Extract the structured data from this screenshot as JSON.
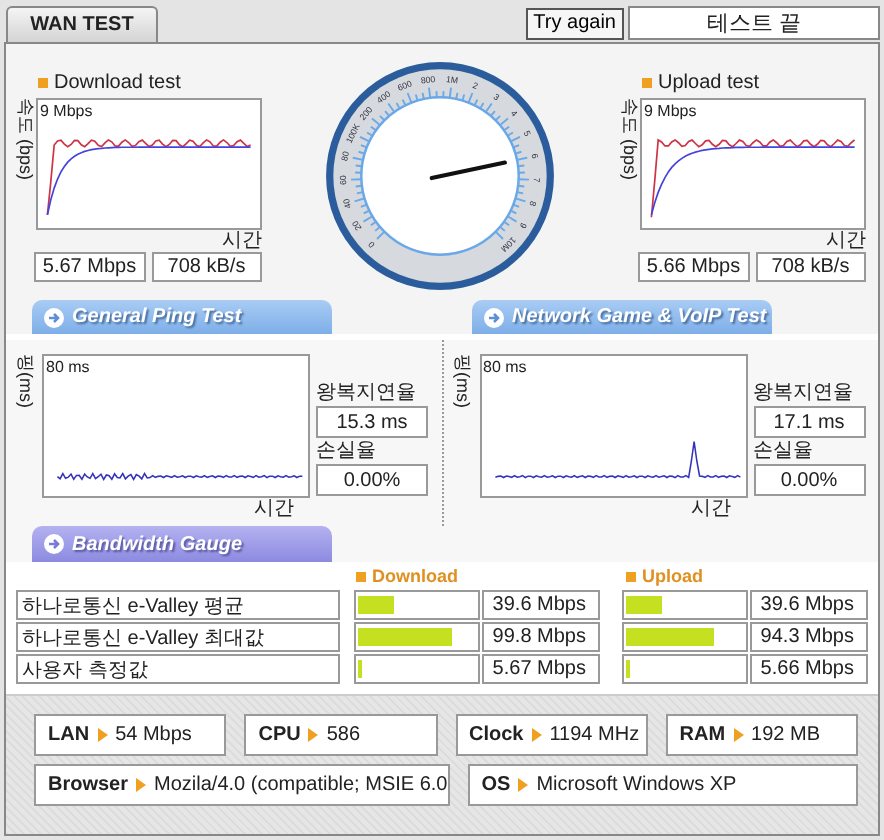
{
  "tab": {
    "label": "WAN TEST",
    "selected": true
  },
  "try_again": "Try again",
  "status": "테스트 끝",
  "speed": {
    "charts": [
      {
        "title": "Download test",
        "y_axis": "속도 (bps)",
        "max": "9 Mbps",
        "x_axis": "시간",
        "mbps": "5.67 Mbps",
        "kbs": "708 kB/s"
      },
      {
        "title": "Upload test",
        "y_axis": "속도 (bps)",
        "max": "9 Mbps",
        "x_axis": "시간",
        "mbps": "5.66 Mbps",
        "kbs": "708 kB/s"
      }
    ],
    "gauge": {
      "labels": [
        "0",
        "20",
        "40",
        "60",
        "80",
        "100K",
        "200",
        "400",
        "600",
        "800",
        "1M",
        "2",
        "3",
        "4",
        "5",
        "6",
        "7",
        "8",
        "9",
        "10M"
      ]
    }
  },
  "ping_tabs": [
    {
      "label": "General Ping Test"
    },
    {
      "label": "Network Game & VoIP Test"
    }
  ],
  "ping": [
    {
      "y_axis": "핑(ms)",
      "max": "80 ms",
      "x_axis": "시간",
      "rtt_label": "왕복지연율",
      "rtt": "15.3 ms",
      "loss_label": "손실율",
      "loss": "0.00%"
    },
    {
      "y_axis": "핑(ms)",
      "max": "80 ms",
      "x_axis": "시간",
      "rtt_label": "왕복지연율",
      "rtt": "17.1 ms",
      "loss_label": "손실율",
      "loss": "0.00%"
    }
  ],
  "bandwidth": {
    "tab": "Bandwidth Gauge",
    "download_header": "Download",
    "upload_header": "Upload",
    "rows": [
      {
        "label": "하나로통신 e-Valley 평균",
        "download": {
          "level": 0.3,
          "reading": "39.6 Mbps"
        },
        "upload": {
          "level": 0.3,
          "reading": "39.6 Mbps"
        }
      },
      {
        "label": "하나로통신 e-Valley 최대값",
        "download": {
          "level": 0.8,
          "reading": "99.8 Mbps"
        },
        "upload": {
          "level": 0.75,
          "reading": "94.3 Mbps"
        }
      },
      {
        "label": "사용자 측정값",
        "download": {
          "level": 0.04,
          "reading": "5.67 Mbps"
        },
        "upload": {
          "level": 0.04,
          "reading": "5.66 Mbps"
        }
      }
    ]
  },
  "system": [
    [
      {
        "label": "LAN",
        "value": "54 Mbps"
      },
      {
        "label": "CPU",
        "value": "586"
      },
      {
        "label": "Clock",
        "value": "1194 MHz"
      },
      {
        "label": "RAM",
        "value": "192 MB"
      }
    ],
    [
      {
        "label": "Browser",
        "value": "Mozila/4.0 (compatible; MSIE 6.0"
      },
      {
        "label": "OS",
        "value": "Microsoft Windows XP"
      }
    ]
  ]
}
